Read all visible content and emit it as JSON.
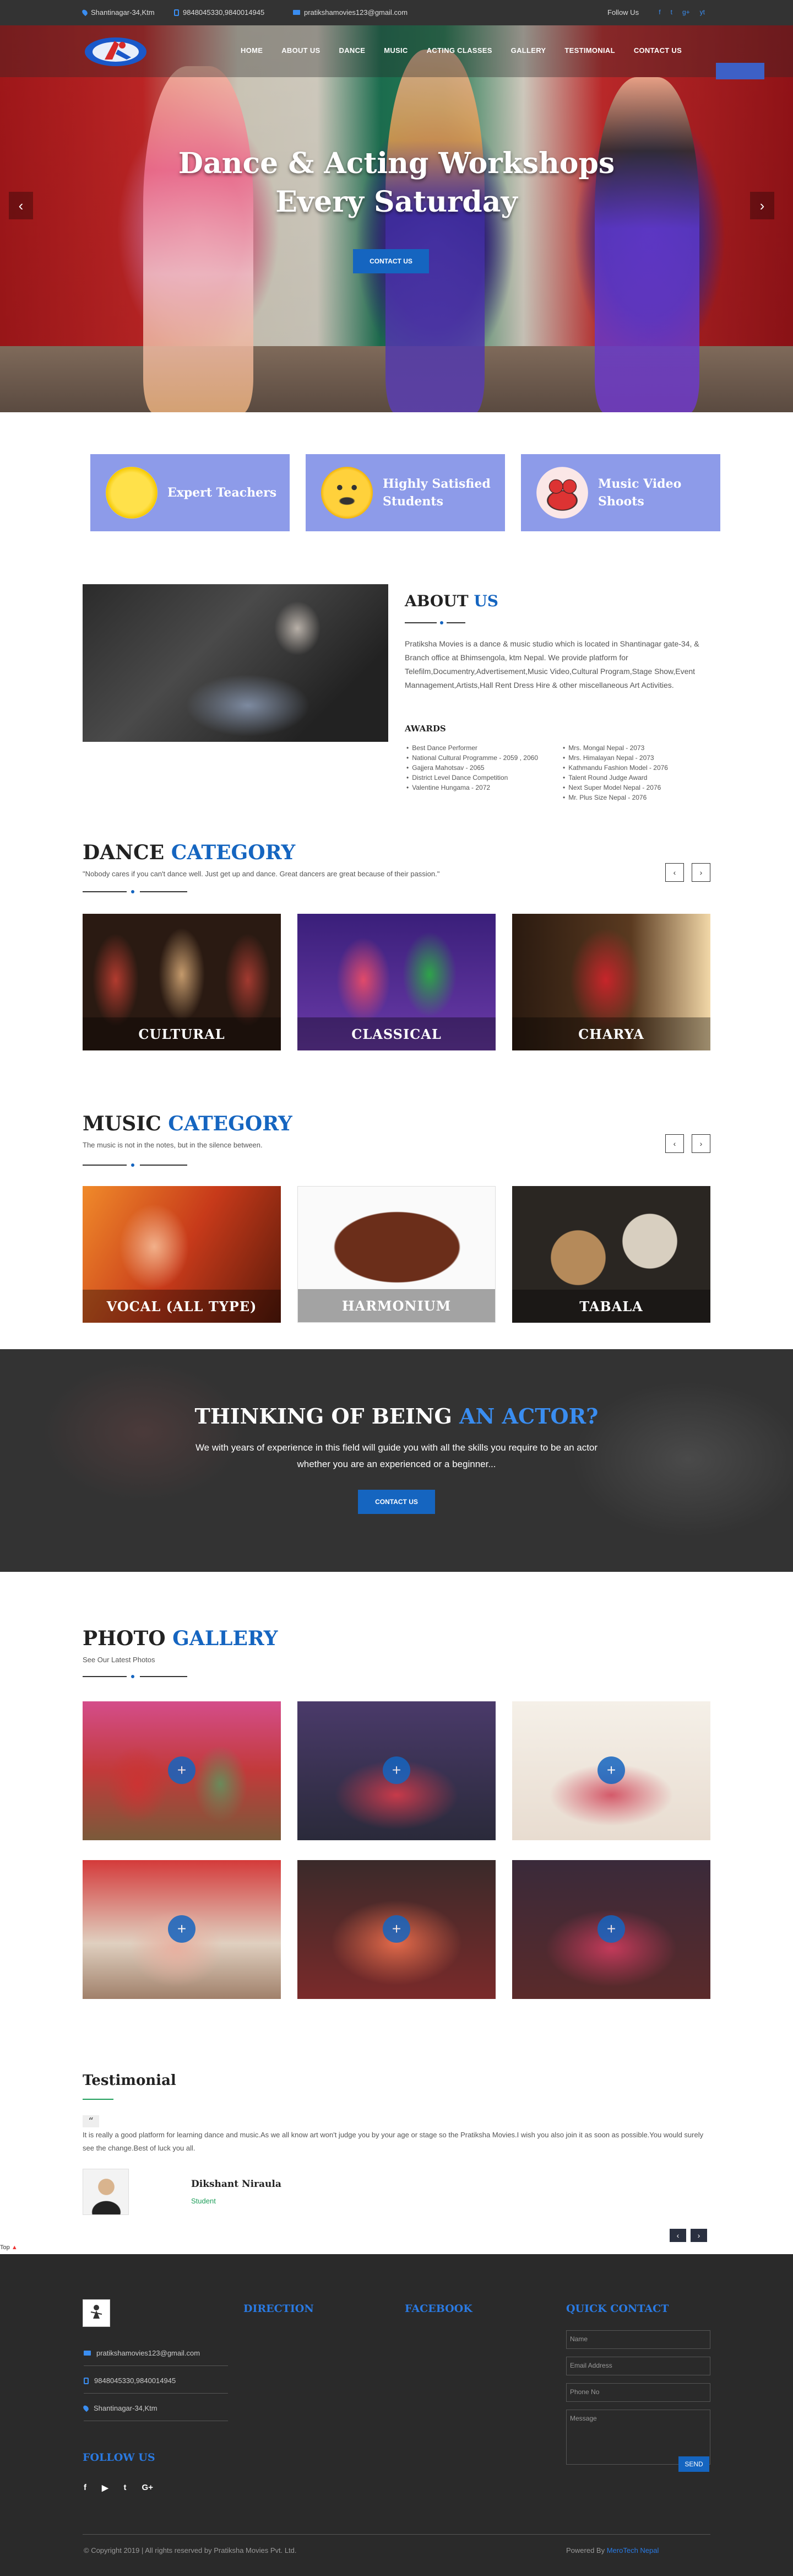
{
  "topbar": {
    "address": "Shantinagar-34,Ktm",
    "phone": "9848045330,9840014945",
    "email": "pratikshamovies123@gmail.com",
    "follow_label": "Follow Us",
    "socials": [
      "f",
      "t",
      "g+",
      "yt"
    ]
  },
  "nav": {
    "items": [
      "HOME",
      "ABOUT US",
      "DANCE",
      "MUSIC",
      "ACTING CLASSES",
      "GALLERY",
      "TESTIMONIAL",
      "CONTACT US"
    ]
  },
  "hero": {
    "title_line1": "Dance & Acting Workshops",
    "title_line2": "Every Saturday",
    "button_label": "CONTACT US",
    "prev": "‹",
    "next": "›"
  },
  "features": [
    {
      "label": "Expert Teachers",
      "icon": "dancer-icon"
    },
    {
      "label": "Highly Satisfied Students",
      "icon": "smiley-icon"
    },
    {
      "label": "Music Video Shoots",
      "icon": "camera-icon"
    }
  ],
  "about": {
    "title_a": "ABOUT",
    "title_b": "US",
    "text": "Pratiksha Movies is a dance & music studio which is located in Shantinagar gate-34, & Branch office at Bhimsengola, ktm Nepal. We provide platform for Telefilm,Documentry,Advertisement,Music Video,Cultural Program,Stage Show,Event Mannagement,Artists,Hall Rent Dress Hire & other miscellaneous Art Activities.",
    "awards_title": "AWARDS",
    "awards_left": [
      "Best Dance Performer",
      "National Cultural Programme - 2059 , 2060",
      "Gajjera Mahotsav - 2065",
      "District Level Dance Competition",
      "Valentine Hungama - 2072"
    ],
    "awards_right": [
      "Mrs. Mongal Nepal - 2073",
      "Mrs. Himalayan Nepal - 2073",
      "Kathmandu Fashion Model - 2076",
      "Talent Round Judge Award",
      "Next Super Model Nepal - 2076",
      "Mr. Plus Size Nepal - 2076"
    ]
  },
  "dance": {
    "title_a": "DANCE",
    "title_b": "CATEGORY",
    "quote": "\"Nobody cares if you can't dance well. Just get up and dance. Great dancers are great because of their passion.\"",
    "cards": [
      "CULTURAL",
      "CLASSICAL",
      "CHARYA"
    ]
  },
  "music": {
    "title_a": "MUSIC",
    "title_b": "CATEGORY",
    "quote": "The music is not in the notes, but in the silence between.",
    "cards": [
      "VOCAL (ALL TYPE)",
      "HARMONIUM",
      "TABALA"
    ]
  },
  "carousel": {
    "prev": "‹",
    "next": "›"
  },
  "actor": {
    "title_a": "THINKING OF BEING",
    "title_b": "AN ACTOR?",
    "text": "We with years of experience in this field will guide you with all the skills you require to be an actor whether you are an experienced or a beginner...",
    "button_label": "CONTACT US"
  },
  "gallery": {
    "title_a": "PHOTO",
    "title_b": "GALLERY",
    "subtitle": "See Our Latest Photos",
    "plus": "+"
  },
  "testimonial": {
    "title": "Testimonial",
    "quote_mark": "“",
    "text": "It is really a good platform for learning dance and music.As we all know art won't judge you by your age or stage so the Pratiksha Movies.I wish you also join it as soon as possible.You would surely see the change.Best of luck you all.",
    "name": "Dikshant Niraula",
    "role": "Student",
    "prev": "‹",
    "next": "›"
  },
  "top_link": "Top",
  "footer": {
    "email": "pratikshamovies123@gmail.com",
    "phone": "9848045330,9840014945",
    "address": "Shantinagar-34,Ktm",
    "direction": "DIRECTION",
    "facebook": "FACEBOOK",
    "quick_contact": "QUICK CONTACT",
    "follow_us": "FOLLOW US",
    "socials": [
      "f",
      "▶",
      "t",
      "G+"
    ],
    "placeholders": {
      "name": "Name",
      "email": "Email Address",
      "phone": "Phone No",
      "message": "Message"
    },
    "send_label": "SEND",
    "copyright": "© Copyright 2019 | All rights reserved by Pratiksha Movies Pvt. Ltd.",
    "powered_prefix": "Powered By",
    "powered_by": "MeroTech Nepal"
  },
  "colors": {
    "accent": "#1565c0",
    "feature_bg": "#8d9be9",
    "footer_bg": "#2a2a2a"
  }
}
